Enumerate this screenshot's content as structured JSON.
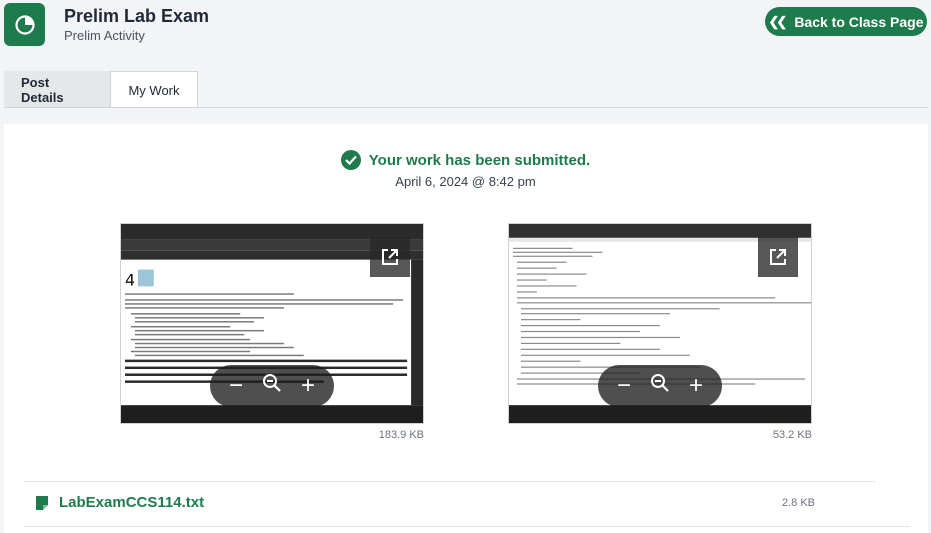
{
  "header": {
    "title": "Prelim Lab Exam",
    "subtitle": "Prelim Activity",
    "back_label": "Back to Class Page"
  },
  "tabs": [
    {
      "label": "Post Details",
      "active": false
    },
    {
      "label": "My Work",
      "active": true
    }
  ],
  "submission": {
    "status": "Your work has been submitted.",
    "date": "April 6, 2024 @ 8:42 pm"
  },
  "attachments": [
    {
      "type": "image",
      "size": "183.9 KB"
    },
    {
      "type": "image",
      "size": "53.2 KB"
    }
  ],
  "file": {
    "name": "LabExamCCS114.txt",
    "size": "2.8 KB"
  },
  "colors": {
    "brand": "#1e7c4c",
    "background": "#f3f4f6"
  }
}
